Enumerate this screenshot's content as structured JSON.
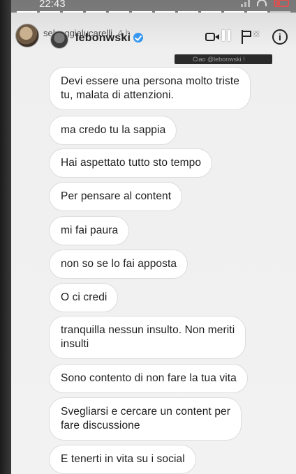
{
  "status_bar": {
    "time": "22:43"
  },
  "progress": {
    "segments": 12,
    "completed": 11
  },
  "header": {
    "uploader_name": "selvaggialucarelli",
    "uploader_age": "4 h",
    "username": "lebonwski",
    "verified": true
  },
  "caption_strip": {
    "text": "Ciao @lebonwski !"
  },
  "icons": [
    "video-call-icon",
    "pause-icon",
    "flag-icon",
    "info-icon"
  ],
  "colors": {
    "bubble_bg": "#ffffff",
    "bubble_border": "#dcdcdc",
    "verified_badge": "#3897f0"
  },
  "messages": [
    "Devi essere una persona molto triste\ntu, malata di attenzioni.",
    "ma credo tu la sappia",
    "Hai aspettato tutto sto tempo",
    "Per pensare al content",
    "mi fai paura",
    "non so se lo fai apposta",
    "O ci credi",
    "tranquilla nessun insulto. Non meriti\ninsulti",
    "Sono contento di non fare la tua vita",
    "Svegliarsi e cercare un content per\nfare discussione",
    "E tenerti in vita su i social"
  ]
}
